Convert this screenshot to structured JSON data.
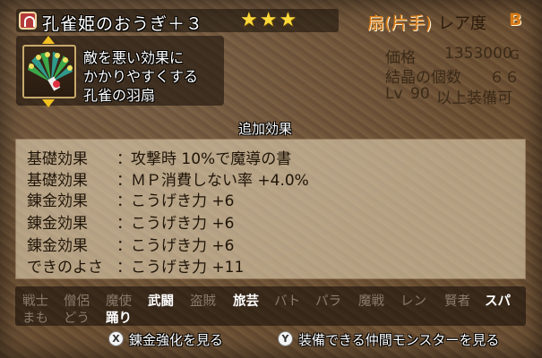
{
  "header": {
    "item_icon": "bracelet-icon",
    "item_name": "孔雀姫のおうぎ＋３",
    "stars": "★★★",
    "item_type": "扇(片手)",
    "rarity_label": "レア度",
    "rarity_value": "B"
  },
  "description": {
    "icon": "peacock-fan-icon",
    "lines": [
      "敵を悪い効果に",
      "かかりやすくする",
      "孔雀の羽扇"
    ]
  },
  "stats": {
    "price_label": "価格",
    "price_value": "1353000",
    "price_unit": "G",
    "crystal_label": "結晶の個数",
    "crystal_value": "６６",
    "level_prefix": "Lv",
    "level_value": "90",
    "level_suffix": "以上装備可"
  },
  "effects": {
    "title": "追加効果",
    "rows": [
      {
        "label": "基礎効果",
        "value": "攻撃時 10%で魔導の書"
      },
      {
        "label": "基礎効果",
        "value": "ＭＰ消費しない率 +4.0%"
      },
      {
        "label": "錬金効果",
        "value": "こうげき力 +6"
      },
      {
        "label": "錬金効果",
        "value": "こうげき力 +6"
      },
      {
        "label": "錬金効果",
        "value": "こうげき力 +6"
      },
      {
        "label": "できのよさ",
        "value": "こうげき力 +11"
      }
    ]
  },
  "jobs": {
    "row1": [
      "戦士",
      "僧侶",
      "魔使",
      "武闘",
      "盗賊",
      "旅芸",
      "バト",
      "パラ",
      "魔戦",
      "レン",
      "賢者",
      "スパ"
    ],
    "row2": [
      "まも",
      "どう",
      "踊り"
    ],
    "row1_active": [
      false,
      false,
      false,
      true,
      false,
      true,
      false,
      false,
      false,
      false,
      false,
      true
    ],
    "row2_active": [
      false,
      false,
      true
    ]
  },
  "footer": {
    "x_button": "X",
    "x_label": "錬金強化を見る",
    "y_button": "Y",
    "y_label": "装備できる仲間モンスターを見る"
  }
}
